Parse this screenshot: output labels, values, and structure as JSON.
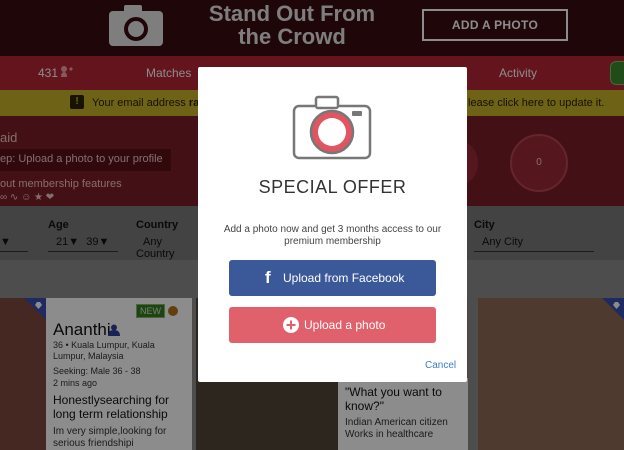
{
  "banner": {
    "title": "Stand Out From the Crowd",
    "cta": "ADD A PHOTO",
    "camera_icon": "camera-icon"
  },
  "nav": {
    "count": "431",
    "matches": "Matches",
    "activity": "Activity",
    "heart_icon": "heart-icon"
  },
  "notice": {
    "text_left_prefix": "Your email address ",
    "text_left_bold": "ras",
    "text_right": "lease click here to update it."
  },
  "promo": {
    "title": "aid",
    "step": "ep: Upload a photo to your profile",
    "features": "out membership features",
    "icons": "∞ ∿ ☺ ★ ❤",
    "circle_count": "0"
  },
  "filters": {
    "age_label": "Age",
    "age_min": "21",
    "age_max": "39",
    "country_label": "Country",
    "country_value": "Any Country",
    "city_label": "City",
    "city_value": "Any City"
  },
  "cards": {
    "c1": {
      "badge": "NEW",
      "name": "Ananthi",
      "location": "36 • Kuala Lumpur, Kuala Lumpur, Malaysia",
      "seeking": "Seeking: Male 36 - 38",
      "time": "2 mins ago",
      "headline": "Honestlysearching for long term relationship",
      "body": "Im very simple,looking for serious friendshipi"
    },
    "c3": {
      "question": "\"What you want to know?\"",
      "text": "Indian American citizen Works in healthcare"
    }
  },
  "modal": {
    "title": "SPECIAL OFFER",
    "description": "Add a photo now and get 3 months access to our premium membership",
    "facebook_button": "Upload from Facebook",
    "facebook_icon_glyph": "f",
    "upload_button": "Upload a photo",
    "cancel": "Cancel"
  },
  "colors": {
    "banner_bg": "#3a0b12",
    "nav_bg": "#b52633",
    "facebook_blue": "#3b5998",
    "upload_pink": "#e0606c",
    "link_blue": "#3b7dc4"
  }
}
